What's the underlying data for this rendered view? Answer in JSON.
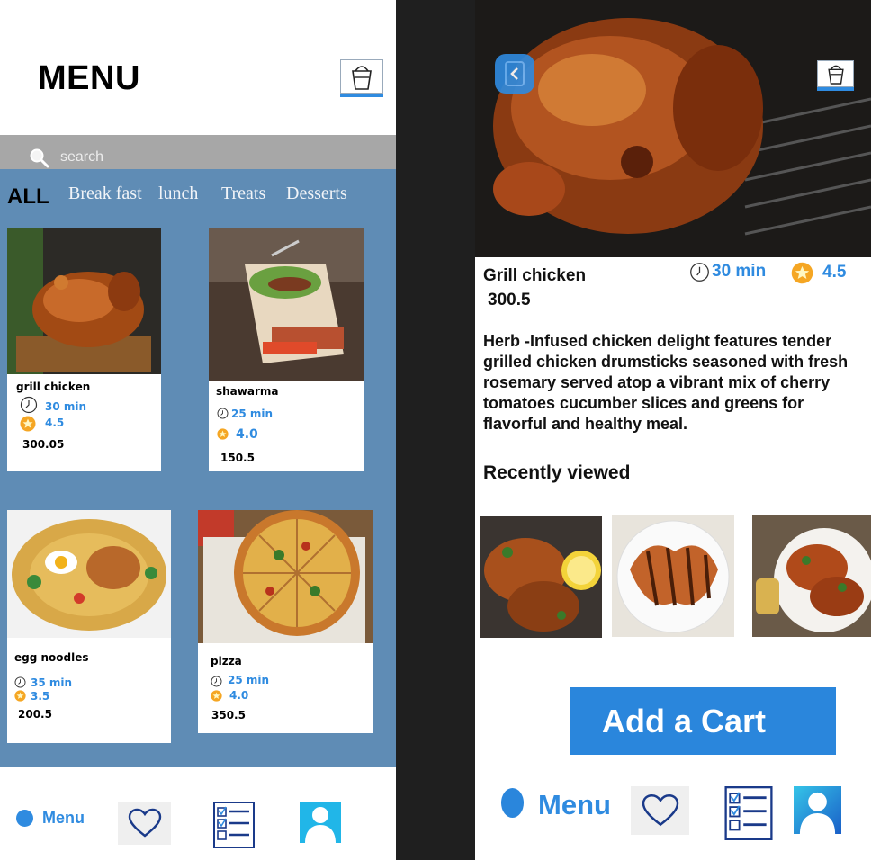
{
  "left": {
    "title": "MENU",
    "search": {
      "placeholder": "search"
    },
    "tabs": [
      {
        "label": "ALL"
      },
      {
        "label": "Break fast"
      },
      {
        "label": "lunch"
      },
      {
        "label": "Treats"
      },
      {
        "label": "Desserts"
      }
    ],
    "items": [
      {
        "name": "grill chicken",
        "time": "30 min",
        "rating": "4.5",
        "price": "300.05"
      },
      {
        "name": "shawarma",
        "time": "25 min",
        "rating": "4.0",
        "price": "150.5"
      },
      {
        "name": "egg noodles",
        "time": "35 min",
        "rating": "3.5",
        "price": "200.5"
      },
      {
        "name": "pizza",
        "time": "25 min",
        "rating": "4.0",
        "price": "350.5"
      }
    ],
    "nav": {
      "menu_label": "Menu"
    }
  },
  "right": {
    "name": "Grill chicken",
    "price": "300.5",
    "time": "30 min",
    "rating": "4.5",
    "description": "Herb -Infused chicken delight features tender grilled chicken drumsticks seasoned with fresh rosemary served atop a vibrant mix of cherry tomatoes cucumber slices and greens for flavorful and healthy meal.",
    "recent_heading": "Recently viewed",
    "add_cart_label": "Add a Cart",
    "nav": {
      "menu_label": "Menu"
    }
  },
  "colors": {
    "accent": "#2f8be0",
    "panel": "#5f8cb5",
    "search_bar": "#a7a7a7"
  }
}
